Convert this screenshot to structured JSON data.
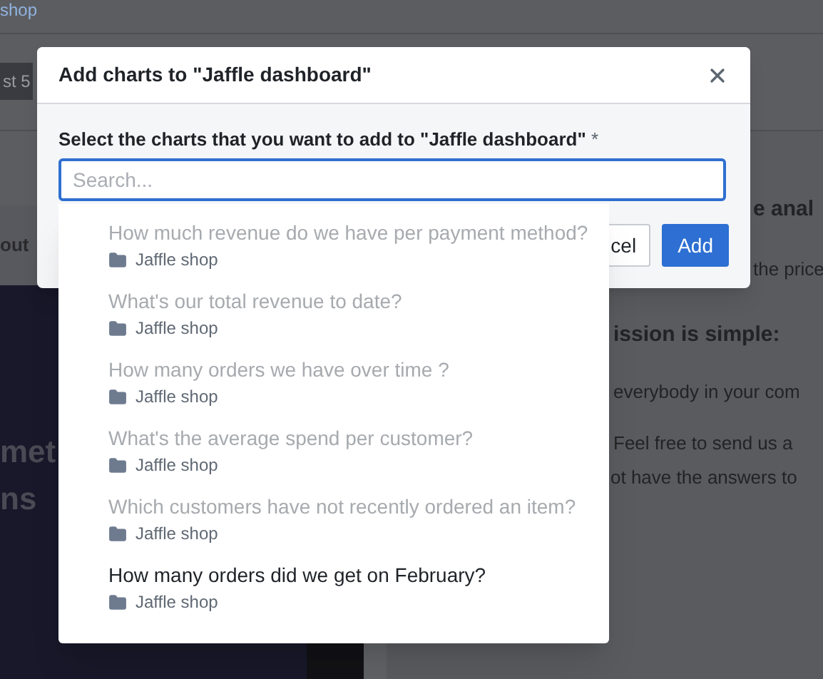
{
  "background": {
    "breadcrumb_link": "shop",
    "badge": "st 5",
    "side_tab": "out",
    "hero_lines": [
      "met",
      "ns"
    ],
    "article": [
      {
        "kind": "heading",
        "text": "e anal"
      },
      {
        "kind": "para",
        "text": "the price"
      },
      {
        "kind": "heading",
        "text": "ission is simple:"
      },
      {
        "kind": "para",
        "text": "everybody in your com"
      },
      {
        "kind": "para",
        "text": "Feel free to send us a"
      },
      {
        "kind": "para",
        "text": "ot have the answers to"
      }
    ]
  },
  "modal": {
    "title": "Add charts to \"Jaffle dashboard\"",
    "field_label": "Select the charts that you want to add to \"Jaffle dashboard\"",
    "required_mark": "*",
    "search": {
      "placeholder": "Search..."
    },
    "options": [
      {
        "title": "How much revenue do we have per payment method?",
        "space": "Jaffle shop",
        "disabled": true
      },
      {
        "title": "What's our total revenue to date?",
        "space": "Jaffle shop",
        "disabled": true
      },
      {
        "title": "How many orders we have over time ?",
        "space": "Jaffle shop",
        "disabled": true
      },
      {
        "title": "What's the average spend per customer?",
        "space": "Jaffle shop",
        "disabled": true
      },
      {
        "title": "Which customers have not recently ordered an item?",
        "space": "Jaffle shop",
        "disabled": true
      },
      {
        "title": "How many orders did we get on February?",
        "space": "Jaffle shop",
        "disabled": false
      }
    ],
    "buttons": [
      {
        "kind": "secondary",
        "label": "cel"
      },
      {
        "kind": "primary",
        "label": "Add"
      }
    ]
  }
}
